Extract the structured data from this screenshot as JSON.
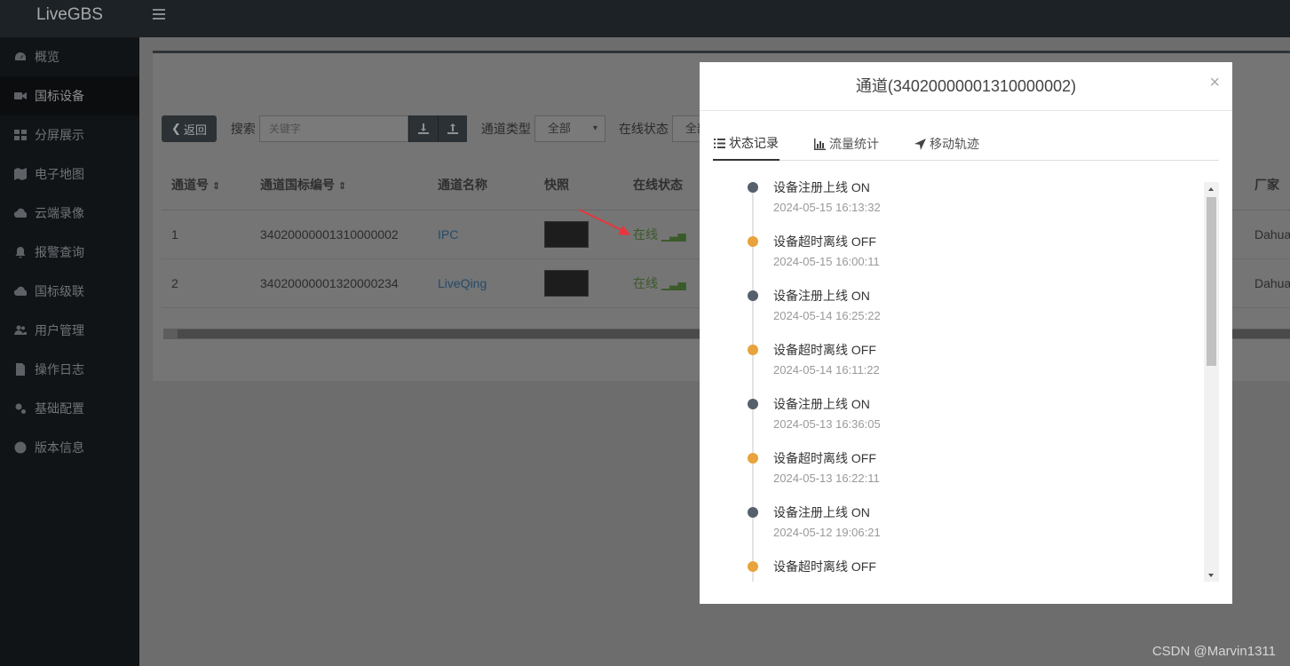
{
  "app": {
    "title": "LiveGBS"
  },
  "sidebar": {
    "items": [
      {
        "label": "概览",
        "icon": "dashboard-icon"
      },
      {
        "label": "国标设备",
        "icon": "video-camera-icon"
      },
      {
        "label": "分屏展示",
        "icon": "grid-icon"
      },
      {
        "label": "电子地图",
        "icon": "map-icon"
      },
      {
        "label": "云端录像",
        "icon": "cloud-icon"
      },
      {
        "label": "报警查询",
        "icon": "bell-icon"
      },
      {
        "label": "国标级联",
        "icon": "cloud-upload-icon"
      },
      {
        "label": "用户管理",
        "icon": "users-icon"
      },
      {
        "label": "操作日志",
        "icon": "file-icon"
      },
      {
        "label": "基础配置",
        "icon": "gears-icon"
      },
      {
        "label": "版本信息",
        "icon": "globe-icon"
      }
    ],
    "active_index": 1
  },
  "toolbar": {
    "back_label": "返回",
    "search_label": "搜索",
    "search_placeholder": "关键字",
    "channel_type_label": "通道类型",
    "channel_type_value": "全部",
    "online_status_label": "在线状态",
    "online_status_value": "全部"
  },
  "table": {
    "headers": [
      "通道号",
      "通道国标编号",
      "通道名称",
      "快照",
      "在线状态",
      "厂家"
    ],
    "rows": [
      {
        "no": "1",
        "gb_id": "34020000001310000002",
        "name": "IPC",
        "status": "在线",
        "vendor": "Dahua"
      },
      {
        "no": "2",
        "gb_id": "34020000001320000234",
        "name": "LiveQing",
        "status": "在线",
        "vendor": "Dahua"
      }
    ]
  },
  "modal": {
    "title": "通道(34020000001310000002)",
    "close": "×",
    "tabs": [
      {
        "label": "状态记录",
        "icon": "list-icon"
      },
      {
        "label": "流量统计",
        "icon": "bar-chart-icon"
      },
      {
        "label": "移动轨迹",
        "icon": "location-arrow-icon"
      }
    ],
    "timeline": [
      {
        "text": "设备注册上线 ON",
        "time": "2024-05-15 16:13:32",
        "state": "on"
      },
      {
        "text": "设备超时离线 OFF",
        "time": "2024-05-15 16:00:11",
        "state": "off"
      },
      {
        "text": "设备注册上线 ON",
        "time": "2024-05-14 16:25:22",
        "state": "on"
      },
      {
        "text": "设备超时离线 OFF",
        "time": "2024-05-14 16:11:22",
        "state": "off"
      },
      {
        "text": "设备注册上线 ON",
        "time": "2024-05-13 16:36:05",
        "state": "on"
      },
      {
        "text": "设备超时离线 OFF",
        "time": "2024-05-13 16:22:11",
        "state": "off"
      },
      {
        "text": "设备注册上线 ON",
        "time": "2024-05-12 19:06:21",
        "state": "on"
      },
      {
        "text": "设备超时离线 OFF",
        "time": "",
        "state": "off"
      }
    ]
  },
  "colors": {
    "on_dot": "#56606d",
    "off_dot": "#e8a33d",
    "annotation": "#e8353d"
  },
  "watermark": "CSDN @Marvin1311"
}
